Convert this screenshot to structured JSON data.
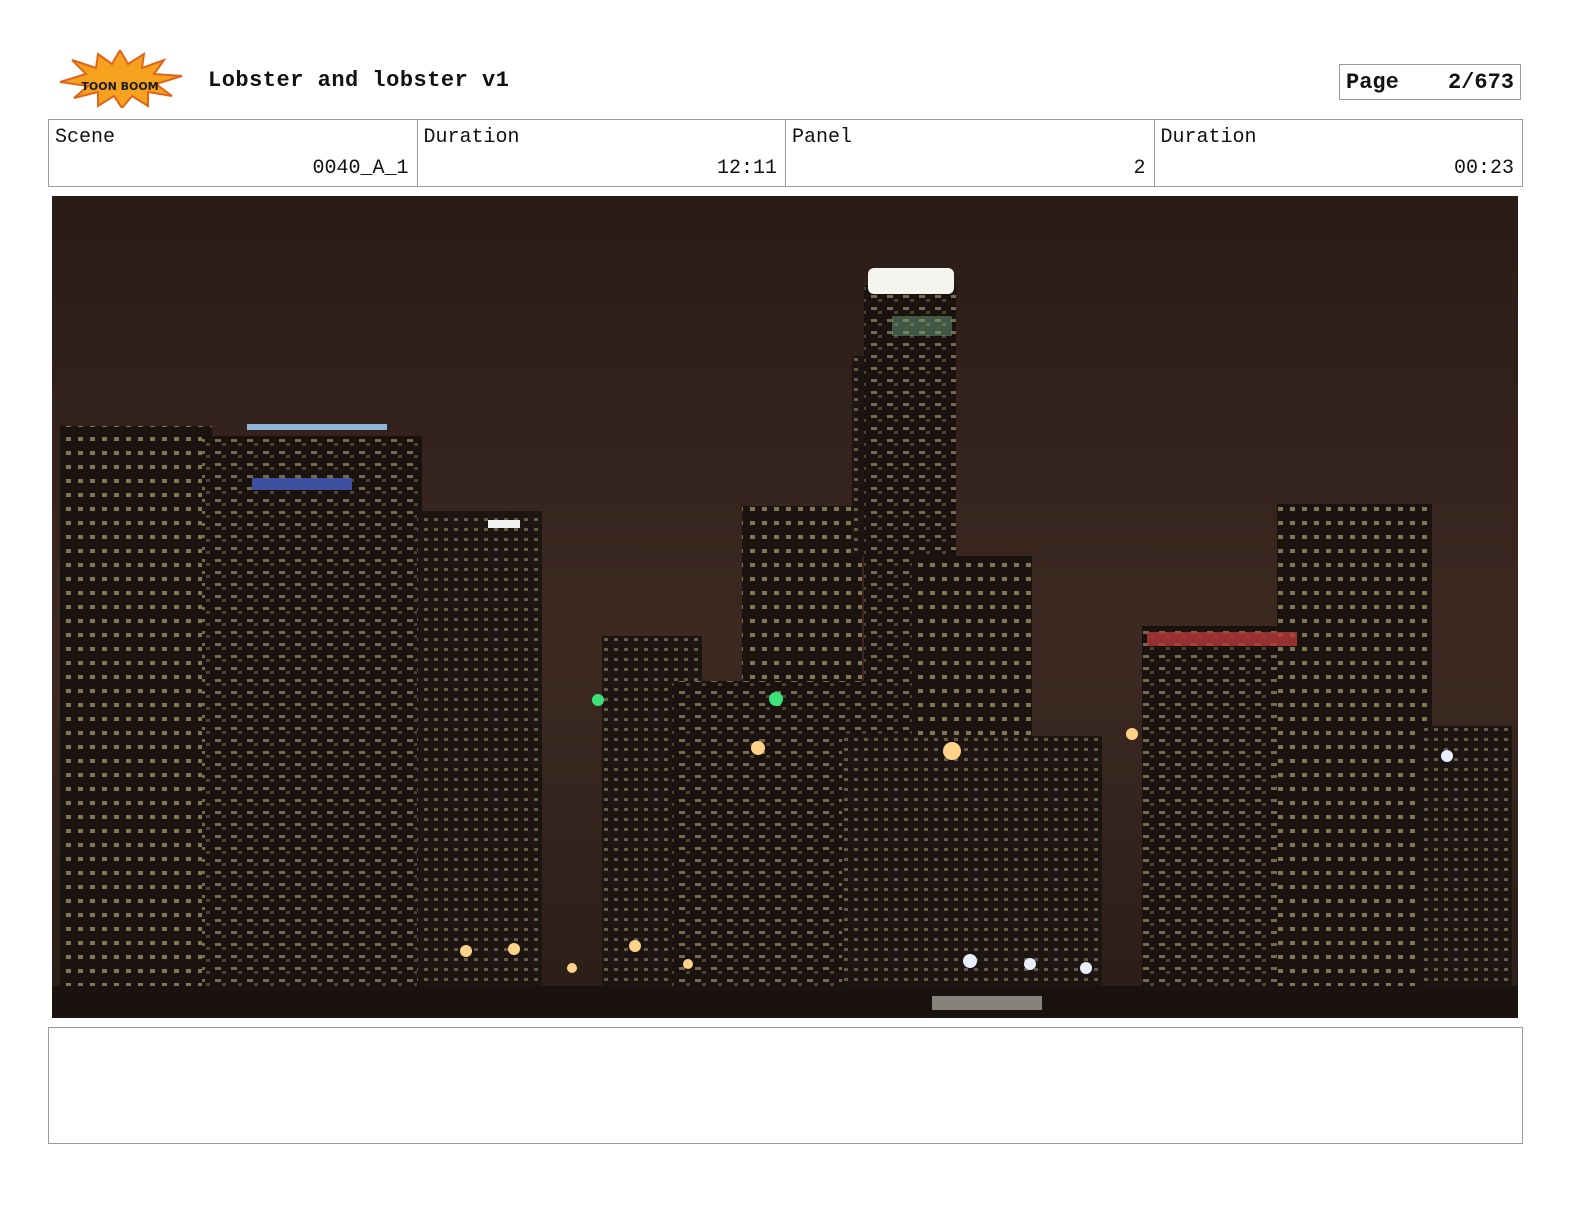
{
  "header": {
    "logo_text": "TOON BOOM",
    "title": "Lobster and lobster v1",
    "page_label": "Page",
    "page_value": "2/673"
  },
  "info": [
    {
      "label": "Scene",
      "value": "0040_A_1"
    },
    {
      "label": "Duration",
      "value": "12:11"
    },
    {
      "label": "Panel",
      "value": "2"
    },
    {
      "label": "Duration",
      "value": "00:23"
    }
  ],
  "panel": {
    "description": "",
    "image_icon": "city-skyline-night"
  },
  "notes": {
    "text": ""
  },
  "colors": {
    "logo_orange": "#f5a623",
    "sky": "#3a2a22",
    "border": "#9a9a9a"
  }
}
